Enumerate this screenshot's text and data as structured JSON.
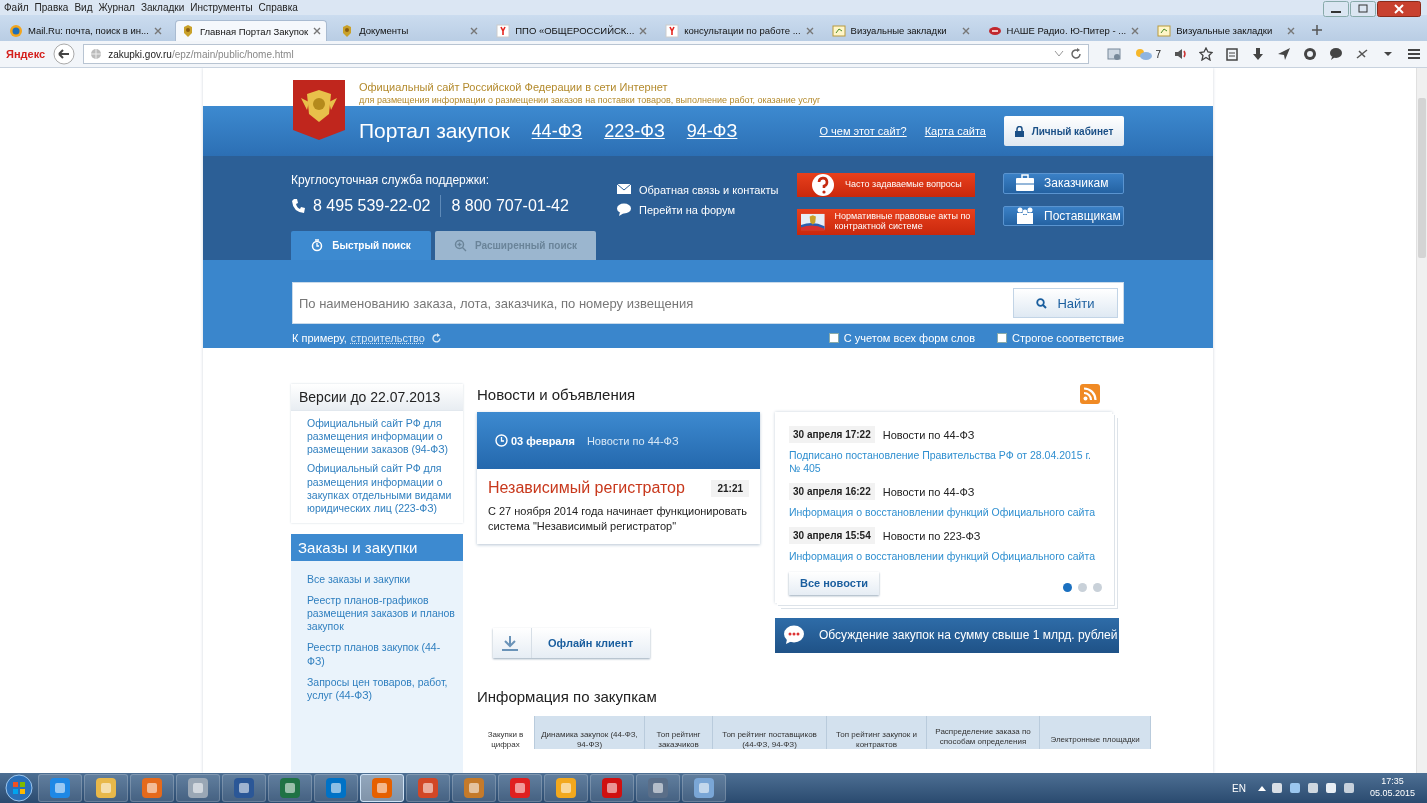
{
  "browser": {
    "menu": [
      "Файл",
      "Правка",
      "Вид",
      "Журнал",
      "Закладки",
      "Инструменты",
      "Справка"
    ],
    "tabs": [
      {
        "title": "Mail.Ru: почта, поиск в ин...",
        "kind": "mail",
        "selected": false
      },
      {
        "title": "Главная Портал Закупок",
        "kind": "emblem",
        "selected": true
      },
      {
        "title": "Документы",
        "kind": "emblem",
        "selected": false
      },
      {
        "title": "ППО «ОБЩЕРОССИЙСК...",
        "kind": "yandex",
        "selected": false
      },
      {
        "title": "консультации по работе ...",
        "kind": "yandex",
        "selected": false
      },
      {
        "title": "Визуальные закладки",
        "kind": "bookmarks",
        "selected": false
      },
      {
        "title": "НАШЕ Радио. Ю-Питер - ...",
        "kind": "radio",
        "selected": false
      },
      {
        "title": "Визуальные закладки",
        "kind": "bookmarks",
        "selected": false
      }
    ],
    "search_engine": "Яндекс",
    "address": {
      "host": "zakupki.gov.ru",
      "path": "/epz/main/public/home.html"
    },
    "weather": "7"
  },
  "header": {
    "title": "Официальный сайт Российской Федерации в сети Интернет",
    "subtitle": "для размещения информации о размещении заказов на поставки товаров, выполнение работ, оказание услуг",
    "portal": "Портал закупок",
    "laws": [
      "44-ФЗ",
      "223-ФЗ",
      "94-ФЗ"
    ],
    "links": [
      "О чем этот сайт?",
      "Карта сайта"
    ],
    "cabinet": "Личный кабинет"
  },
  "support": {
    "label": "Круглосуточная служба поддержки:",
    "phones": [
      "8 495 539-22-02",
      "8 800 707-01-42"
    ]
  },
  "contacts": [
    {
      "kind": "mail",
      "text": "Обратная связь и контакты"
    },
    {
      "kind": "chat",
      "text": "Перейти на форум"
    }
  ],
  "red_buttons": [
    {
      "kind": "question",
      "text": "Часто задаваемые вопросы"
    },
    {
      "kind": "emblem",
      "text": "Нормативные правовые акты по контрактной системе"
    }
  ],
  "role_buttons": [
    {
      "kind": "customers",
      "text": "Заказчикам"
    },
    {
      "kind": "suppliers",
      "text": "Поставщикам"
    }
  ],
  "search": {
    "tabs": [
      {
        "label": "Быстрый поиск",
        "selected": true
      },
      {
        "label": "Расширенный поиск",
        "selected": false
      }
    ],
    "placeholder": "По наименованию заказа, лота, заказчика, по номеру извещения",
    "button": "Найти",
    "example_label": "К примеру,",
    "example_link": "строительство",
    "options": [
      {
        "label": "С учетом всех форм слов",
        "checked": false
      },
      {
        "label": "Строгое соответствие",
        "checked": false
      }
    ]
  },
  "sidebar": {
    "versions": {
      "title": "Версии до 22.07.2013",
      "links": [
        "Официальный сайт РФ для размещения информации о размещении заказов (94-ФЗ)",
        "Официальный сайт РФ для размещения информации о закупках отдельными видами юридических лиц (223-ФЗ)"
      ]
    },
    "orders": {
      "title": "Заказы и закупки",
      "links": [
        "Все заказы и закупки",
        "Реестр планов-графиков размещения заказов и планов закупок",
        "Реестр планов закупок (44-ФЗ)",
        "Запросы цен товаров, работ, услуг (44-ФЗ)"
      ]
    }
  },
  "news": {
    "title": "Новости и объявления",
    "featured": {
      "date": "03 февраля",
      "category": "Новости по 44-ФЗ",
      "headline": "Независимый регистратор",
      "time": "21:21",
      "text": "С 27 ноября 2014 года начинает функционировать система \"Независимый регистратор\""
    },
    "items": [
      {
        "date": "30 апреля 17:22",
        "category": "Новости по 44-ФЗ",
        "link": "Подписано постановление Правительства РФ от 28.04.2015 г. № 405"
      },
      {
        "date": "30 апреля 16:22",
        "category": "Новости по 44-ФЗ",
        "link": "Информация о восстановлении функций Официального сайта"
      },
      {
        "date": "30 апреля 15:54",
        "category": "Новости по 223-ФЗ",
        "link": "Информация о восстановлении функций Официального сайта"
      }
    ],
    "all_button": "Все новости",
    "pages": [
      {
        "selected": true
      },
      {
        "selected": false
      },
      {
        "selected": false
      }
    ],
    "offline_button": "Офлайн клиент",
    "discussion_button": "Обсуждение закупок на сумму свыше 1 млрд. рублей"
  },
  "info": {
    "title": "Информация по закупкам",
    "tabs": [
      {
        "label": "Закупки в цифрах",
        "selected": true
      },
      {
        "label": "Динамика закупок (44-ФЗ, 94-ФЗ)",
        "selected": false
      },
      {
        "label": "Топ рейтинг заказчиков",
        "selected": false
      },
      {
        "label": "Топ рейтинг поставщиков (44-ФЗ, 94-ФЗ)",
        "selected": false
      },
      {
        "label": "Топ рейтинг закупок и контрактов",
        "selected": false
      },
      {
        "label": "Распределение заказа по способам определения",
        "selected": false
      },
      {
        "label": "Электронные площадки",
        "selected": false
      }
    ]
  },
  "taskbar": {
    "apps": [
      {
        "selected": false
      },
      {
        "selected": false
      },
      {
        "selected": false
      },
      {
        "selected": false
      },
      {
        "selected": false
      },
      {
        "selected": false
      },
      {
        "selected": false
      },
      {
        "selected": true
      },
      {
        "selected": false
      },
      {
        "selected": false
      },
      {
        "selected": false
      },
      {
        "selected": false
      },
      {
        "selected": false
      },
      {
        "selected": false
      },
      {
        "selected": false
      }
    ],
    "language": "EN",
    "time": "17:35",
    "date": "05.05.2015"
  }
}
